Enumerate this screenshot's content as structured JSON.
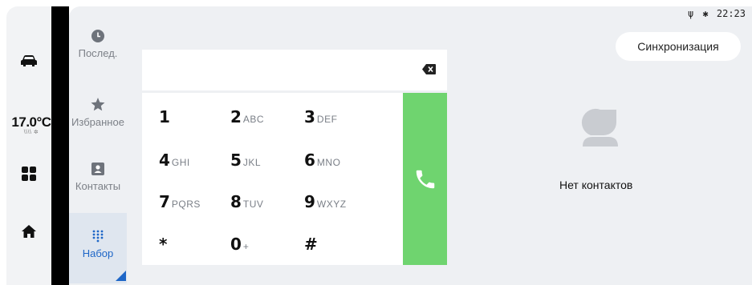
{
  "status_bar": {
    "time": "22:23"
  },
  "header": {
    "sync_label": "Синхронизация"
  },
  "side_rail": {
    "temperature": "17.0°C",
    "fan_level": "\\\\\\\\ ✲"
  },
  "nav": [
    {
      "label": "Послед."
    },
    {
      "label": "Избранное"
    },
    {
      "label": "Контакты"
    },
    {
      "label": "Набор"
    }
  ],
  "keypad": {
    "display_value": "",
    "keys": [
      {
        "digit": "1",
        "letters": ""
      },
      {
        "digit": "2",
        "letters": "ABC"
      },
      {
        "digit": "3",
        "letters": "DEF"
      },
      {
        "digit": "4",
        "letters": "GHI"
      },
      {
        "digit": "5",
        "letters": "JKL"
      },
      {
        "digit": "6",
        "letters": "MNO"
      },
      {
        "digit": "7",
        "letters": "PQRS"
      },
      {
        "digit": "8",
        "letters": "TUV"
      },
      {
        "digit": "9",
        "letters": "WXYZ"
      },
      {
        "digit": "*",
        "letters": ""
      },
      {
        "digit": "0",
        "letters": "+"
      },
      {
        "digit": "#",
        "letters": ""
      }
    ]
  },
  "contacts": {
    "empty_text": "Нет контактов"
  },
  "colors": {
    "call_green": "#6fd46f",
    "accent_blue": "#1e66c7"
  }
}
